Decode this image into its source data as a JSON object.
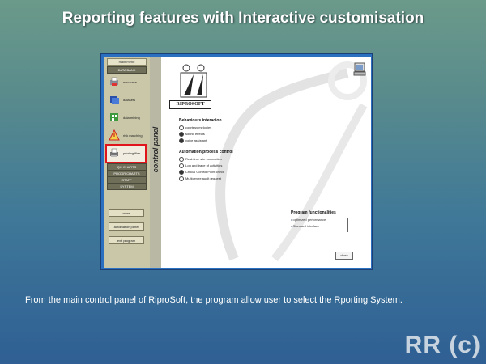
{
  "slide": {
    "title": "Reporting features with Interactive customisation",
    "caption": "From the main control panel of RiproSoft, the program allow user to select the Rporting System.",
    "footer": "RR (c)"
  },
  "left_panel": {
    "top_button": "main menu",
    "data_bank_header": "DATA BANK",
    "items": [
      {
        "label": "new case",
        "icon": "printer-icon"
      },
      {
        "label": "datasets",
        "icon": "database-icon"
      },
      {
        "label": "data mining",
        "icon": "spreadsheet-icon"
      },
      {
        "label": "risk matching",
        "icon": "warning-icon"
      },
      {
        "label": "printing files",
        "icon": "printer-report-icon",
        "selected": true
      }
    ],
    "section_headers": [
      "QC CHARTS",
      "PROGR CHARTS",
      "STAFF",
      "SYSTEM"
    ],
    "bottom_buttons": [
      "more",
      "automation panel",
      "exit program"
    ],
    "selection_color": "#e0141b"
  },
  "control_panel_label": "control panel",
  "main": {
    "logo": "RIPROSOFT",
    "behaviour": {
      "title": "Behaviours interacion",
      "options": [
        {
          "label": "courtesy melodies",
          "on": false
        },
        {
          "label": "sound effects",
          "on": true
        },
        {
          "label": "voice assistant",
          "on": true
        }
      ]
    },
    "automation": {
      "title": "Automation/process control",
      "options": [
        {
          "label": "Real-time site connection",
          "on": false
        },
        {
          "label": "Log and trace of activities",
          "on": false
        },
        {
          "label": "Critical Control Point check",
          "on": true
        },
        {
          "label": "Multicentre audit request",
          "on": false
        }
      ]
    },
    "program": {
      "title": "Program functionalities",
      "items": [
        "optimized performance",
        "Standard interface"
      ]
    },
    "close_label": "close"
  }
}
